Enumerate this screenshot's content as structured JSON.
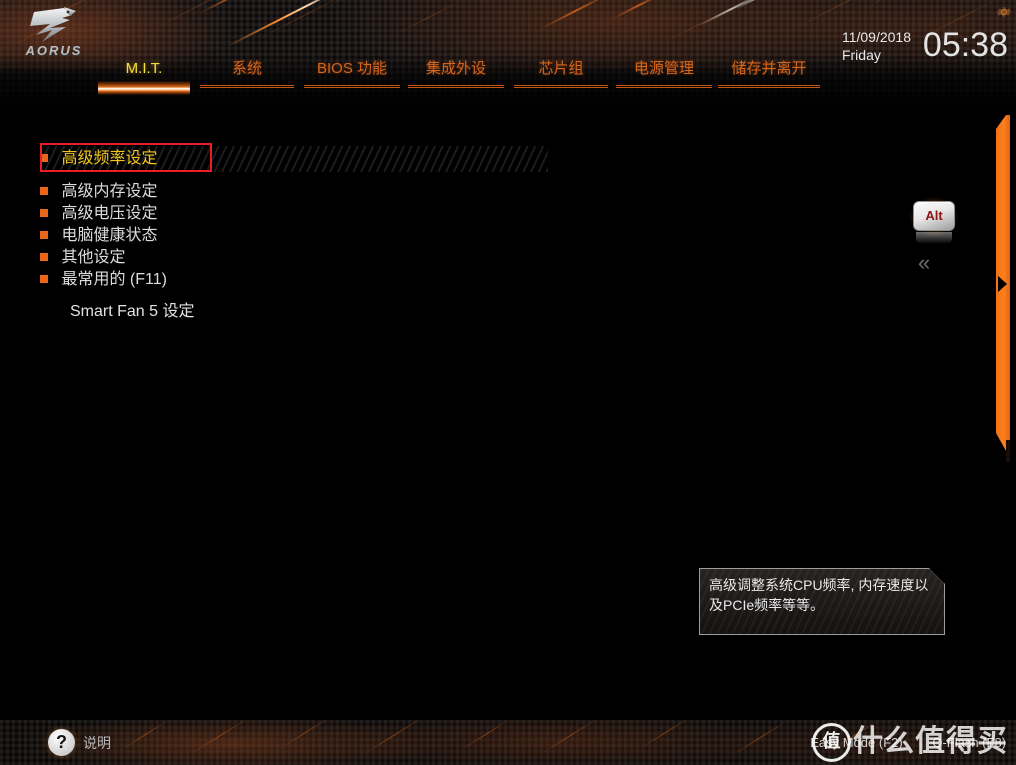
{
  "brand": {
    "name": "AORUS",
    "logo_icon": "aorus-falcon-icon"
  },
  "header": {
    "tabs": [
      {
        "label": "M.I.T.",
        "active": true
      },
      {
        "label": "系统",
        "active": false
      },
      {
        "label": "BIOS 功能",
        "active": false
      },
      {
        "label": "集成外设",
        "active": false
      },
      {
        "label": "芯片组",
        "active": false
      },
      {
        "label": "电源管理",
        "active": false
      },
      {
        "label": "储存并离开",
        "active": false
      }
    ],
    "clock": {
      "date": "11/09/2018",
      "weekday": "Friday",
      "time": "05:38"
    },
    "corner_icon": "gear-icon"
  },
  "main": {
    "menu_items": [
      {
        "label": "高级频率设定",
        "selected": true
      },
      {
        "label": "高级内存设定",
        "selected": false
      },
      {
        "label": "高级电压设定",
        "selected": false
      },
      {
        "label": "电脑健康状态",
        "selected": false
      },
      {
        "label": "其他设定",
        "selected": false
      },
      {
        "label": "最常用的 (F11)",
        "selected": false
      }
    ],
    "secondary_item": {
      "label": "Smart Fan 5 设定"
    },
    "tooltip": {
      "text": "高级调整系统CPU频率, 内存速度以及PCIe频率等等。"
    },
    "alt_key": {
      "label": "Alt",
      "icon": "alt-key-icon"
    },
    "collapse": {
      "glyph": "«",
      "icon": "chevron-double-left-icon"
    }
  },
  "footer": {
    "help": {
      "glyph": "?",
      "label": "说明"
    },
    "easy_mode": "Easy Mode (F2)",
    "qflash": "Q-Flash (F8)"
  },
  "watermark": {
    "badge": "值",
    "text": "什么值得买"
  },
  "colors": {
    "accent_orange": "#e9661a",
    "tab_orange": "#d4651c",
    "active_yellow": "#f0c419",
    "annotation_red": "#ee1c25",
    "rail_orange": "#ff7f1f"
  }
}
